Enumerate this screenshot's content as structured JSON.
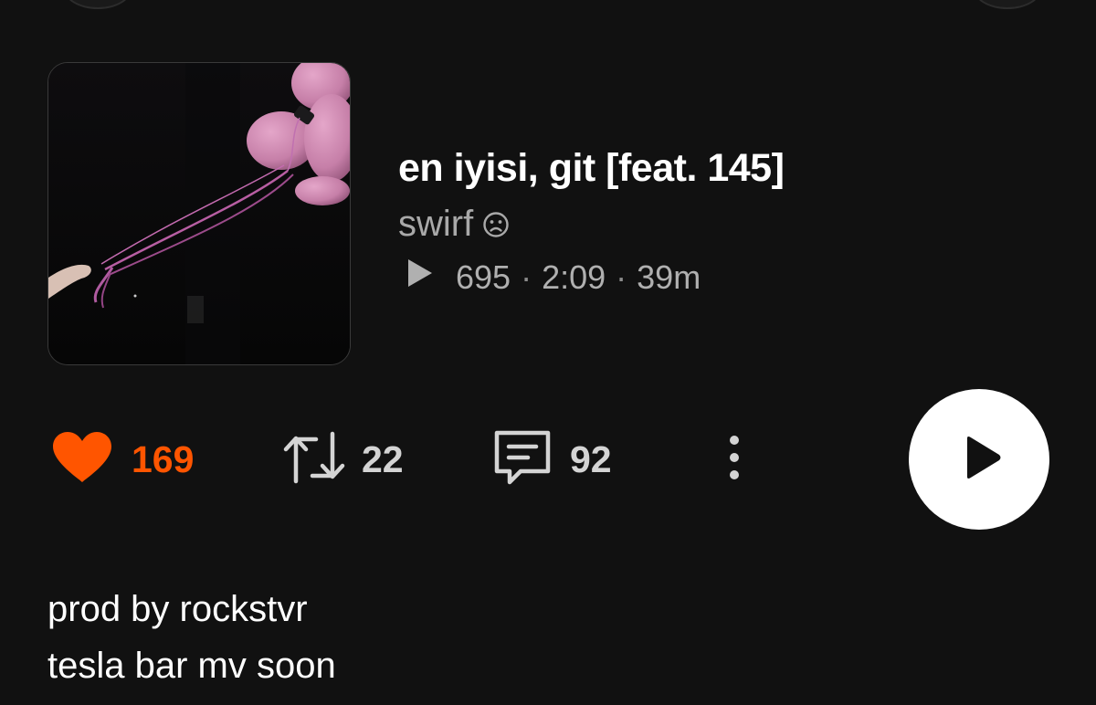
{
  "track": {
    "title": "en iyisi, git [feat. 145]",
    "artist": "swirf",
    "artist_emoji": "☹",
    "plays": "695",
    "separator": "·",
    "duration": "2:09",
    "posted_ago": "39m"
  },
  "actions": {
    "likes": "169",
    "reposts": "22",
    "comments": "92"
  },
  "description": {
    "line1": "prod by rockstvr",
    "line2": "tesla bar mv soon"
  },
  "colors": {
    "background": "#111111",
    "accent": "#ff5500",
    "secondary_text": "#a9a9a9"
  },
  "icons": {
    "like": "heart-icon",
    "repost": "repost-icon",
    "comment": "comment-icon",
    "more": "more-vertical-icon",
    "play": "play-icon"
  }
}
